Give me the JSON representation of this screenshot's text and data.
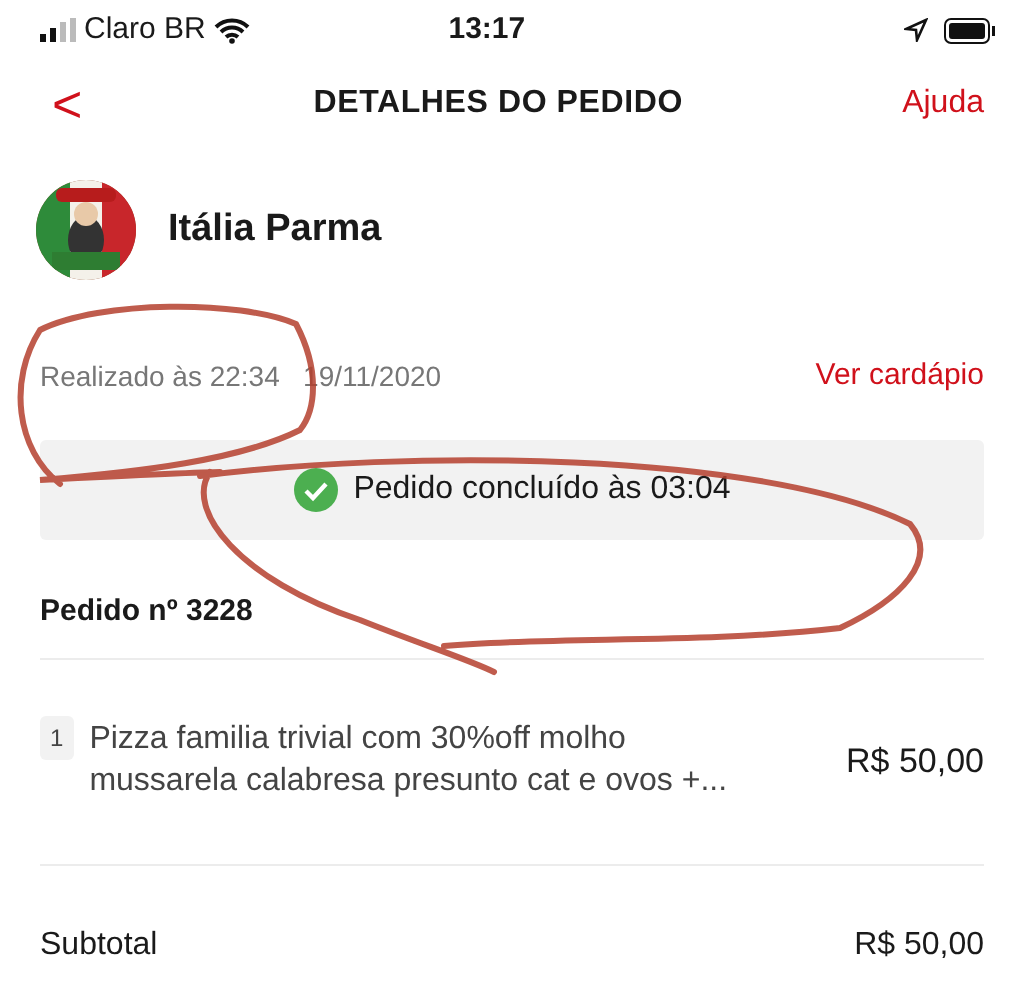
{
  "status_bar": {
    "carrier": "Claro BR",
    "time": "13:17"
  },
  "header": {
    "back": "<",
    "title": "DETALHES DO PEDIDO",
    "help": "Ajuda"
  },
  "store": {
    "name": "Itália Parma"
  },
  "placed": {
    "time": "Realizado às 22:34",
    "date": "19/11/2020",
    "menu_link": "Ver cardápio"
  },
  "status": {
    "text": "Pedido concluído às 03:04",
    "completed": true
  },
  "order": {
    "number": "Pedido nº 3228",
    "items": [
      {
        "qty": "1",
        "description": "Pizza familia trivial com 30%off molho mussarela calabresa presunto cat e ovos +...",
        "price": "R$ 50,00"
      }
    ]
  },
  "totals": [
    {
      "label": "Subtotal",
      "value": "R$ 50,00"
    }
  ]
}
